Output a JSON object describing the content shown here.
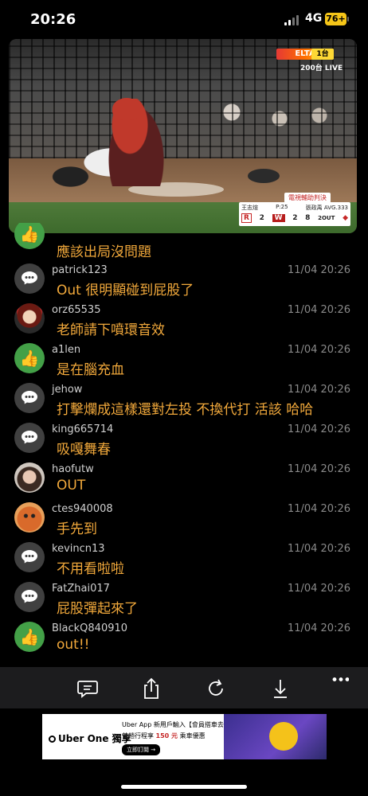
{
  "status": {
    "time": "20:26",
    "network": "4G",
    "battery": "76+"
  },
  "video": {
    "channel_logo": "ELTA",
    "channel_num": "1台",
    "live_label": "200台 LIVE",
    "replay_badge": "電視輔助判決",
    "scoreboard": {
      "pitcher": "王志煊",
      "pitch_count": "P:25",
      "batter": "張政禹 AVG.333",
      "team1": "R",
      "score1": "2",
      "team2": "W",
      "score2": "2",
      "inning": "8",
      "outs": "2OUT"
    }
  },
  "messages": [
    {
      "user": "",
      "time": "",
      "text": "應該出局沒問題",
      "avatar": "like-icon"
    },
    {
      "user": "patrick123",
      "time": "11/04 20:26",
      "text": "Out 很明顯碰到屁股了",
      "avatar": "chat-icon"
    },
    {
      "user": "orz65535",
      "time": "11/04 20:26",
      "text": "老師請下噴環音效",
      "avatar": "doll-avatar"
    },
    {
      "user": "a1len",
      "time": "11/04 20:26",
      "text": "是在腦充血",
      "avatar": "like-icon"
    },
    {
      "user": "jehow",
      "time": "11/04 20:26",
      "text": "打擊爛成這樣還對左投 不換代打 活該 哈哈",
      "avatar": "chat-icon"
    },
    {
      "user": "king665714",
      "time": "11/04 20:26",
      "text": "吸嘎舞春",
      "avatar": "chat-icon"
    },
    {
      "user": "haofutw",
      "time": "11/04 20:26",
      "text": "OUT",
      "avatar": "girl-avatar"
    },
    {
      "user": "ctes940008",
      "time": "11/04 20:26",
      "text": "手先到",
      "avatar": "crab-avatar"
    },
    {
      "user": "kevincn13",
      "time": "11/04 20:26",
      "text": "不用看啦啦",
      "avatar": "chat-icon"
    },
    {
      "user": "FatZhai017",
      "time": "11/04 20:26",
      "text": "屁股彈起來了",
      "avatar": "chat-icon"
    },
    {
      "user": "BlackQ840910",
      "time": "11/04 20:26",
      "text": "out!!",
      "avatar": "like-icon"
    }
  ],
  "toolbar": [
    "comment-icon",
    "share-icon",
    "refresh-icon",
    "download-icon",
    "more-icon"
  ],
  "ad": {
    "brand": "Uber One 獨享",
    "line1": "Uber App 新用戶輸入【會員搭車去】",
    "line2_pre": "首趟行程享",
    "line2_amount": "150 元",
    "line2_post": "乘車優惠",
    "cta": "立即訂閱 →"
  }
}
